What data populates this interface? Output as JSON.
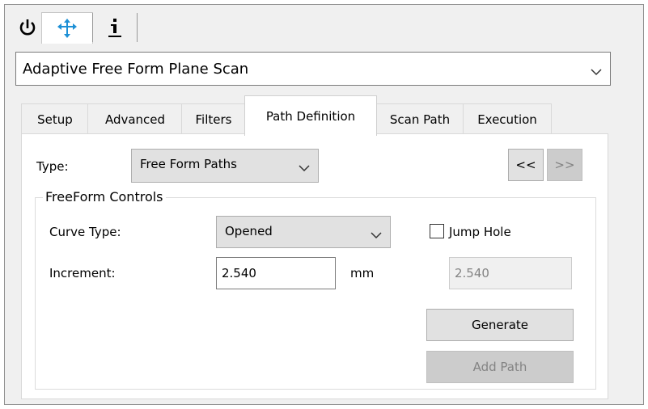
{
  "toolbar": {
    "icons": [
      "power-icon",
      "move-icon",
      "info-icon"
    ]
  },
  "mode_select": {
    "value": "Adaptive Free Form Plane Scan"
  },
  "tabs": [
    {
      "label": "Setup",
      "active": false
    },
    {
      "label": "Advanced",
      "active": false
    },
    {
      "label": "Filters",
      "active": false
    },
    {
      "label": "Path Definition",
      "active": true
    },
    {
      "label": "Scan Path",
      "active": false
    },
    {
      "label": "Execution",
      "active": false
    }
  ],
  "path_definition": {
    "type_label": "Type:",
    "type_value": "Free Form Paths",
    "prev_button": "<<",
    "next_button": ">>",
    "group_title": "FreeForm Controls",
    "curve_type_label": "Curve Type:",
    "curve_type_value": "Opened",
    "jump_hole_label": "Jump Hole",
    "jump_hole_checked": false,
    "increment_label": "Increment:",
    "increment_value": "2.540",
    "increment_unit": "mm",
    "jump_value": "2.540",
    "generate_button": "Generate",
    "add_path_button": "Add Path"
  },
  "colors": {
    "accent": "#1e90d6",
    "disabled_text": "#838383"
  }
}
